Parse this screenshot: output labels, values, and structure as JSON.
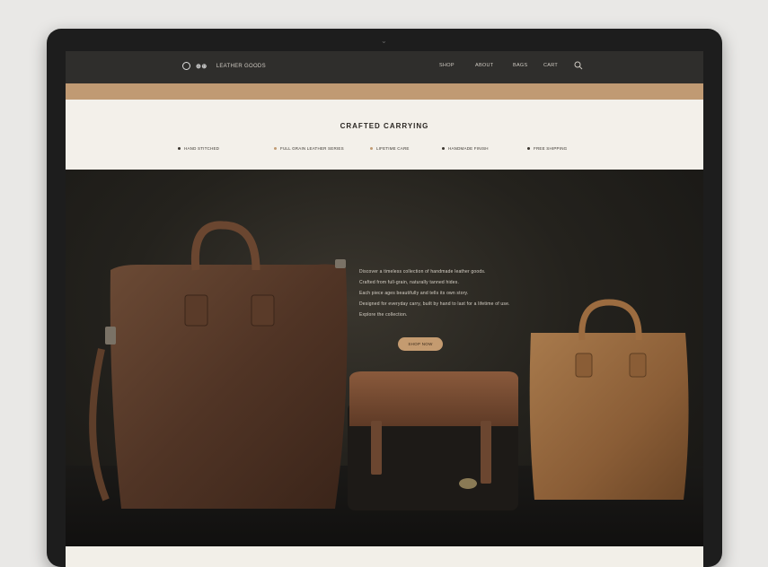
{
  "device": {
    "camera_glyph": "⌄"
  },
  "nav": {
    "logo_mark": "⊕⊛",
    "brand": "LEATHER GOODS",
    "menu": [
      "SHOP",
      "ABOUT",
      "BAGS",
      "CART"
    ]
  },
  "info": {
    "title": "CRAFTED CARRYING",
    "features": [
      "HAND STITCHED",
      "FULL GRAIN LEATHER SERIES",
      "LIFETIME CARE",
      "HANDMADE FINISH",
      "FREE SHIPPING"
    ]
  },
  "hero": {
    "lines": [
      "Discover a timeless collection of handmade leather goods.",
      "Crafted from full-grain, naturally tanned hides.",
      "Each piece ages beautifully and tells its own story.",
      "Designed for everyday carry, built by hand to last for a lifetime of use.",
      "Explore the collection."
    ],
    "cta": "SHOP NOW"
  },
  "colors": {
    "nav_bg": "#2f2e2c",
    "accent": "#c09a73",
    "cream": "#f3f0ea",
    "hero_dark": "#1a1917"
  },
  "icons": {
    "search": "search-icon",
    "logo": "logo-icon"
  }
}
